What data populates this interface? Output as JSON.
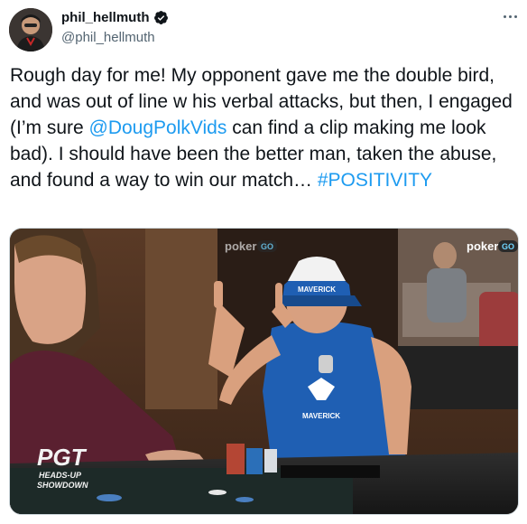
{
  "author": {
    "display_name": "phil_hellmuth",
    "handle": "@phil_hellmuth",
    "verified": true,
    "avatar_icon": "profile-photo"
  },
  "menu_icon": "more-horizontal-icon",
  "tweet": {
    "text_part1": "Rough day for me! My opponent gave me the double bird, and was out of line w his verbal attacks, but then, I engaged (I’m sure ",
    "mention": "@DougPolkVids",
    "text_part2": " can find a clip making me look bad). I should have been the better man, taken the abuse, and found a way to win our match… ",
    "hashtag": "#POSITIVITY"
  },
  "media": {
    "watermark_left": "poker",
    "watermark_right": "poker",
    "watermark_suffix": "GO",
    "event_logo": "PGT",
    "event_subtitle_1": "HEADS-UP",
    "event_subtitle_2": "SHOWDOWN",
    "cap_text": "MAVERICK",
    "shirt_text": "MAVERICK"
  },
  "colors": {
    "link": "#1d9bf0",
    "verified_badge": "#0f1419",
    "text_primary": "#0f1419",
    "text_secondary": "#536471",
    "shirt_blue": "#1f5fb3"
  }
}
